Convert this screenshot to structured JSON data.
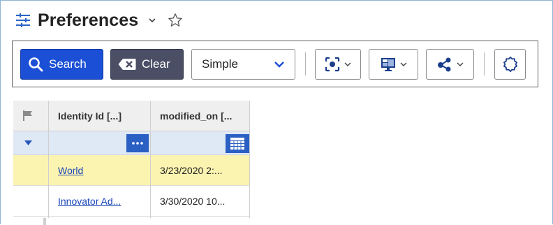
{
  "header": {
    "title": "Preferences"
  },
  "toolbar": {
    "search_label": "Search",
    "clear_label": "Clear",
    "mode_value": "Simple"
  },
  "grid": {
    "columns": [
      "Identity Id [...]",
      "modified_on [..."
    ],
    "rows": [
      {
        "identity": "World",
        "modified": "3/23/2020 2:...",
        "highlighted": true
      },
      {
        "identity": "Innovator Ad...",
        "modified": "3/30/2020 10..."
      }
    ]
  },
  "colors": {
    "accent": "#1b4fd6",
    "clear": "#4a4f66",
    "row_highlight": "#fbf3b0",
    "filter_row": "#dfe8f5",
    "link": "#1a47b8"
  }
}
